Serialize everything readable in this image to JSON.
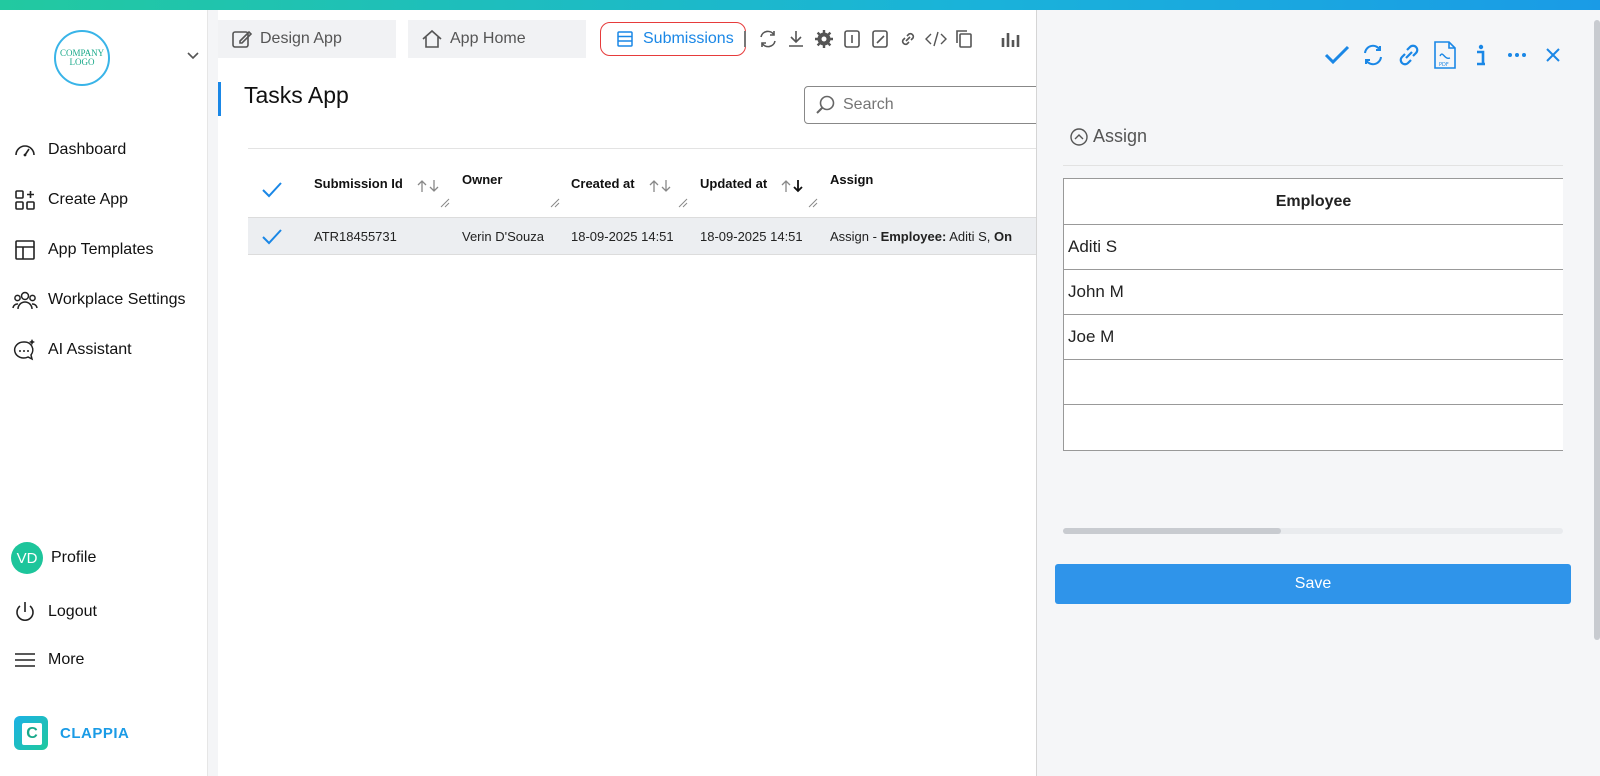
{
  "sidebar": {
    "logo_text": "COMPANY LOGO",
    "items": [
      {
        "label": "Dashboard",
        "icon": "dashboard-gauge-icon"
      },
      {
        "label": "Create App",
        "icon": "create-app-icon"
      },
      {
        "label": "App Templates",
        "icon": "templates-icon"
      },
      {
        "label": "Workplace Settings",
        "icon": "users-icon"
      },
      {
        "label": "AI Assistant",
        "icon": "chat-sparkle-icon"
      }
    ],
    "profile": {
      "initials": "VD",
      "label": "Profile"
    },
    "logout_label": "Logout",
    "more_label": "More",
    "brand": "CLAPPIA"
  },
  "tabs": [
    {
      "label": "Design App",
      "icon": "edit-icon"
    },
    {
      "label": "App Home",
      "icon": "home-icon"
    },
    {
      "label": "Submissions",
      "icon": "list-icon",
      "active": true
    }
  ],
  "page": {
    "title": "Tasks App",
    "search_placeholder": "Search"
  },
  "table": {
    "columns": [
      "Submission Id",
      "Owner",
      "Created at",
      "Updated at",
      "Assign"
    ],
    "rows": [
      {
        "submission_id": "ATR18455731",
        "owner": "Verin D'Souza",
        "created_at": "18-09-2025 14:51",
        "updated_at": "18-09-2025 14:51",
        "assign_prefix": "Assign - ",
        "assign_bold": "Employee:",
        "assign_value": " Aditi S, ",
        "assign_more": "On"
      }
    ]
  },
  "panel": {
    "section_title": "Assign",
    "grid_header": "Employee",
    "employees": [
      "Aditi S",
      "John M",
      "Joe M",
      "",
      ""
    ],
    "save_label": "Save"
  },
  "colors": {
    "accent": "#1a87e6",
    "save": "#2f94ea",
    "active_tab_border": "#e63b3b",
    "avatar": "#1dc59b"
  }
}
